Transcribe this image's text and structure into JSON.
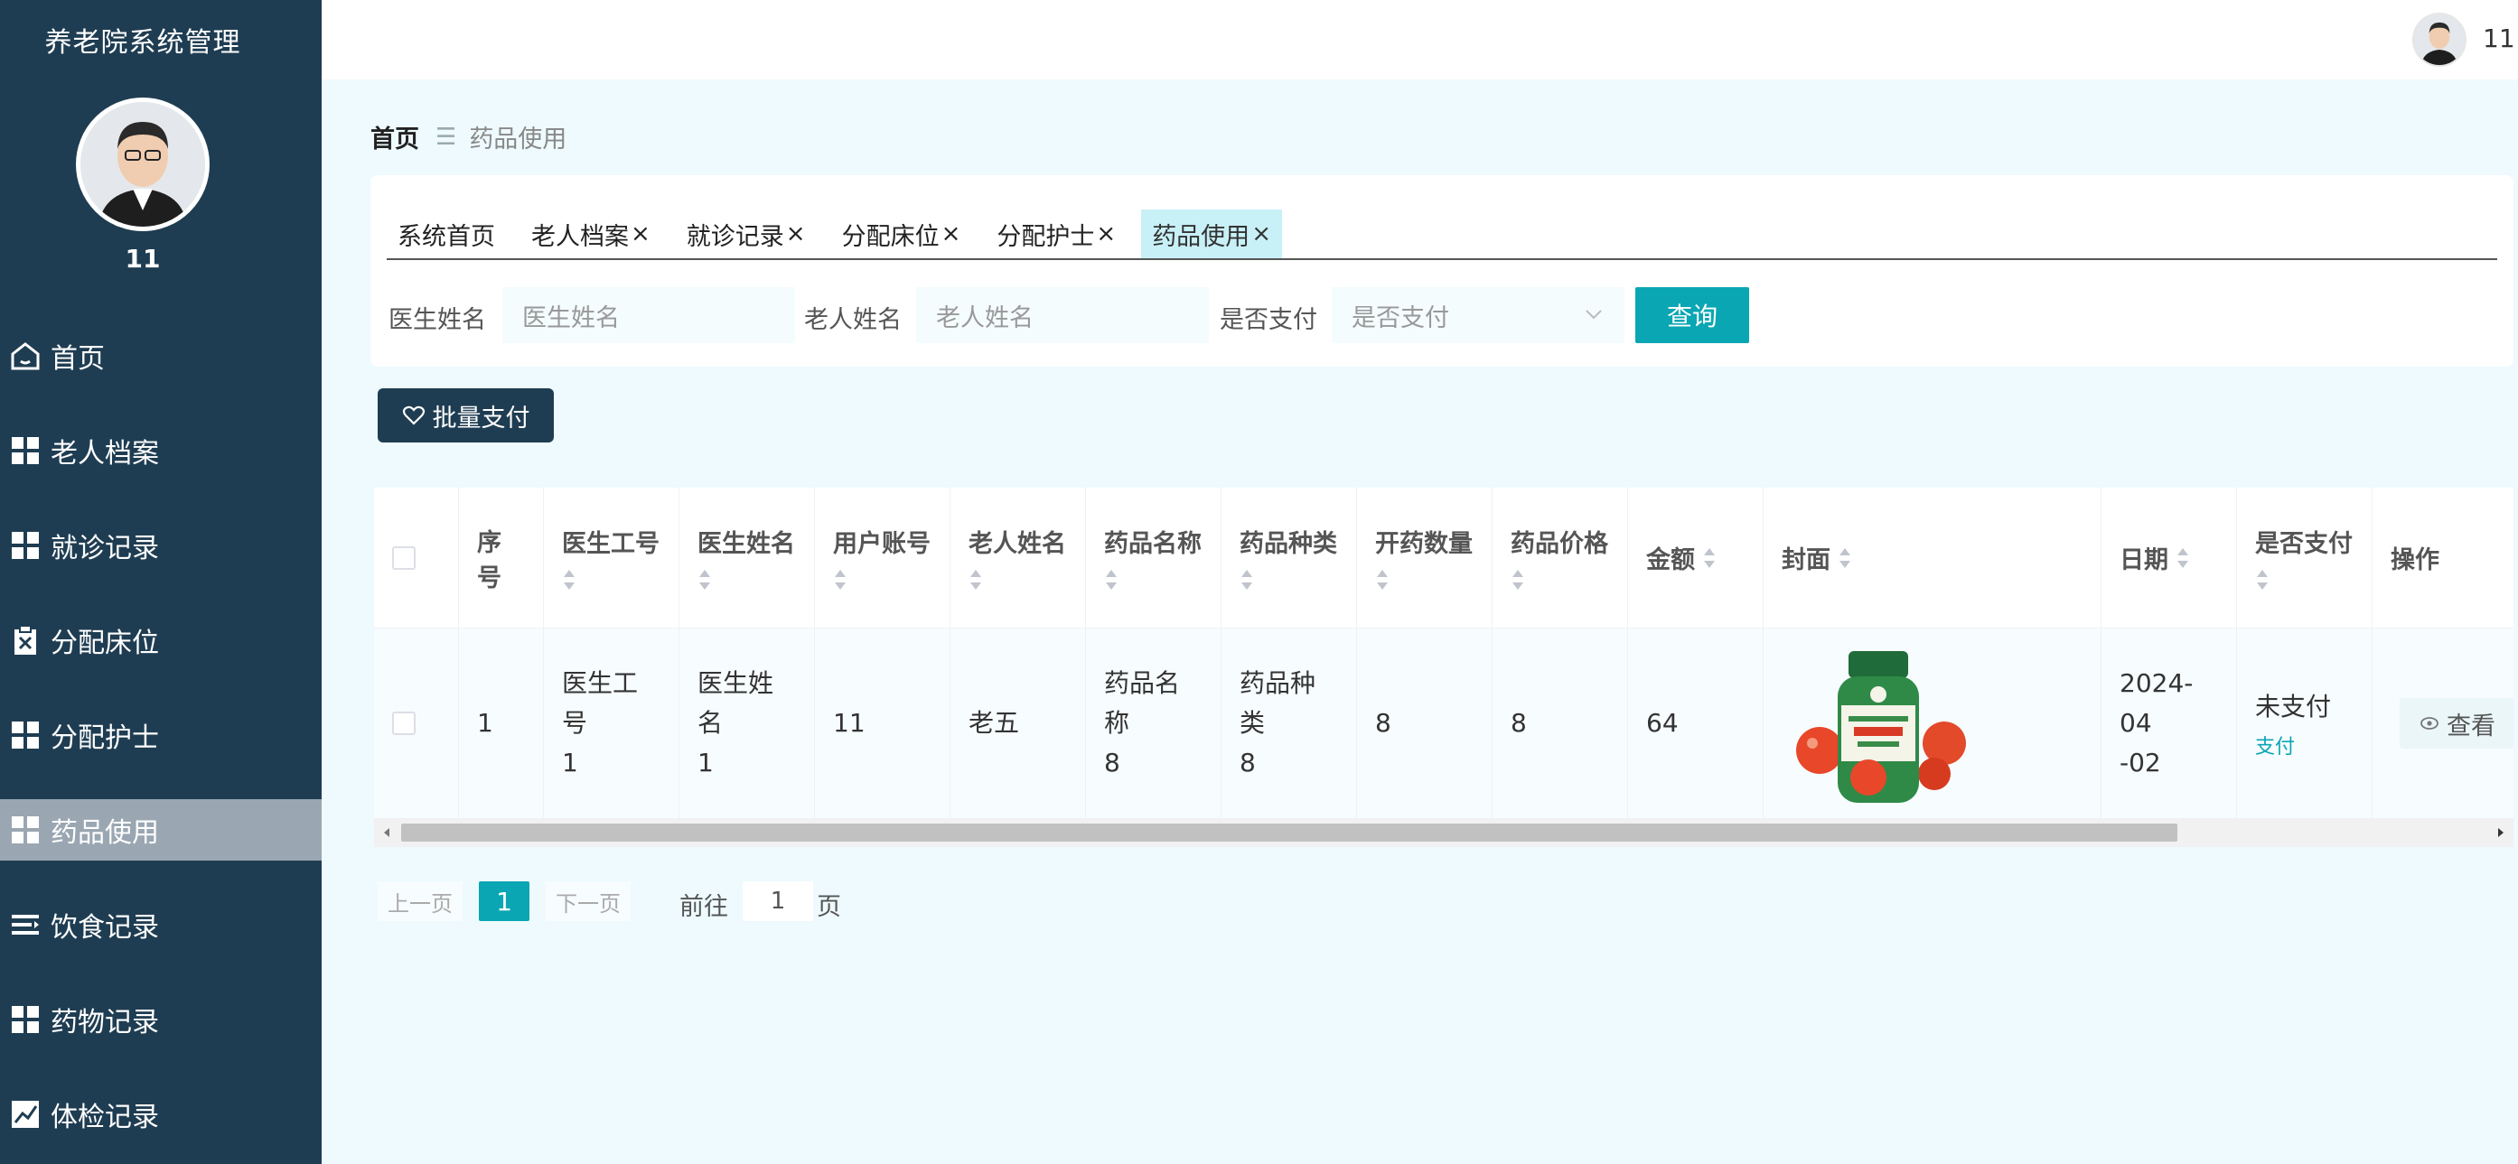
{
  "app": {
    "title": "养老院系统管理",
    "username": "11"
  },
  "sidebar": {
    "items": [
      {
        "label": "首页",
        "icon": "home-icon"
      },
      {
        "label": "老人档案",
        "icon": "grid-icon"
      },
      {
        "label": "就诊记录",
        "icon": "grid-icon"
      },
      {
        "label": "分配床位",
        "icon": "clipboard-x-icon"
      },
      {
        "label": "分配护士",
        "icon": "grid-icon"
      },
      {
        "label": "药品使用",
        "icon": "grid-icon",
        "active": true
      },
      {
        "label": "饮食记录",
        "icon": "list-icon"
      },
      {
        "label": "药物记录",
        "icon": "grid-icon"
      },
      {
        "label": "体检记录",
        "icon": "chart-icon"
      }
    ]
  },
  "breadcrumb": {
    "home": "首页",
    "separator": "☰",
    "current": "药品使用"
  },
  "tabs": [
    {
      "label": "系统首页",
      "closable": false
    },
    {
      "label": "老人档案",
      "closable": true
    },
    {
      "label": "就诊记录",
      "closable": true
    },
    {
      "label": "分配床位",
      "closable": true
    },
    {
      "label": "分配护士",
      "closable": true
    },
    {
      "label": "药品使用",
      "closable": true,
      "active": true
    }
  ],
  "tab_close": "×",
  "filters": {
    "doctor_label": "医生姓名",
    "doctor_placeholder": "医生姓名",
    "elder_label": "老人姓名",
    "elder_placeholder": "老人姓名",
    "paid_label": "是否支付",
    "paid_placeholder": "是否支付",
    "query_button": "查询"
  },
  "batch_button": "批量支付",
  "table": {
    "headers": {
      "index": "序号",
      "doctor_id": "医生工号",
      "doctor_name": "医生姓名",
      "account": "用户账号",
      "elder_name": "老人姓名",
      "drug_name": "药品名称",
      "drug_type": "药品种类",
      "quantity": "开药数量",
      "price": "药品价格",
      "amount": "金额",
      "cover": "封面",
      "date": "日期",
      "paid": "是否支付",
      "action": "操作"
    },
    "rows": [
      {
        "index": "1",
        "doctor_id_1": "医生工号",
        "doctor_id_2": "1",
        "doctor_name_1": "医生姓名",
        "doctor_name_2": "1",
        "account": "11",
        "elder_name": "老五",
        "drug_name_1": "药品名称",
        "drug_name_2": "8",
        "drug_type_1": "药品种类",
        "drug_type_2": "8",
        "quantity": "8",
        "price": "8",
        "amount": "64",
        "date_1": "2024-04",
        "date_2": "-02",
        "paid_status": "未支付",
        "pay_link": "支付",
        "view_button": "查看"
      }
    ]
  },
  "pagination": {
    "prev": "上一页",
    "current": "1",
    "next": "下一页",
    "goto_label": "前往",
    "goto_value": "1",
    "page_label": "页"
  },
  "colors": {
    "sidebar_bg": "#1f3d52",
    "accent": "#0aa6b3",
    "active_tab": "#c8f0f7",
    "page_bg": "#eefafd"
  }
}
